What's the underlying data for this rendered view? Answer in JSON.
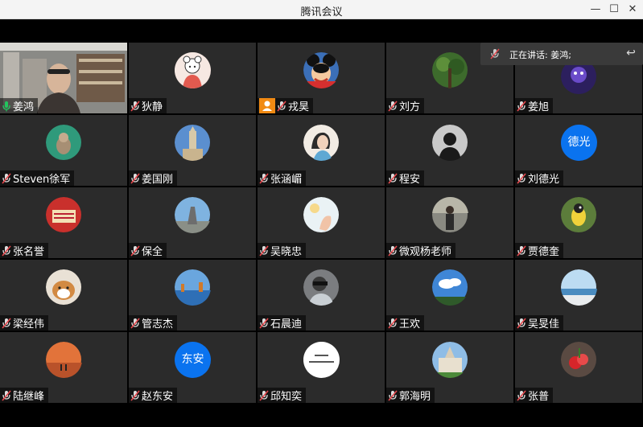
{
  "window": {
    "title": "腾讯会议",
    "minimize": "—",
    "maximize": "☐",
    "close": "✕"
  },
  "speaking_banner": {
    "text": "正在讲话: 姜鸿;"
  },
  "avatar_texts": {
    "liudeguang": "德光",
    "zhaodongan": "东安"
  },
  "colors": {
    "active_border": "#1fbf4f",
    "host_badge": "#f18a13",
    "text_avatar": "#0a73ef",
    "tile_bg": "#2b2b2b"
  },
  "participants": [
    {
      "name": "姜鸿",
      "mic": "on"
    },
    {
      "name": "狄静",
      "mic": "muted"
    },
    {
      "name": "戎昊",
      "mic": "muted",
      "host": true
    },
    {
      "name": "刘方",
      "mic": "muted"
    },
    {
      "name": "姜旭",
      "mic": "muted"
    },
    {
      "name": "Steven徐军",
      "mic": "muted"
    },
    {
      "name": "姜国刚",
      "mic": "muted"
    },
    {
      "name": "张涵嵋",
      "mic": "muted"
    },
    {
      "name": "程安",
      "mic": "muted"
    },
    {
      "name": "刘德光",
      "mic": "muted"
    },
    {
      "name": "张名誉",
      "mic": "muted"
    },
    {
      "name": "保全",
      "mic": "muted"
    },
    {
      "name": "吴晓忠",
      "mic": "muted"
    },
    {
      "name": "微观杨老师",
      "mic": "muted"
    },
    {
      "name": "贾德奎",
      "mic": "muted"
    },
    {
      "name": "梁经伟",
      "mic": "muted"
    },
    {
      "name": "管志杰",
      "mic": "muted"
    },
    {
      "name": "石晨迪",
      "mic": "muted"
    },
    {
      "name": "王欢",
      "mic": "muted"
    },
    {
      "name": "吴旻佳",
      "mic": "muted"
    },
    {
      "name": "陆继峰",
      "mic": "muted"
    },
    {
      "name": "赵东安",
      "mic": "muted"
    },
    {
      "name": "邱知奕",
      "mic": "muted"
    },
    {
      "name": "郭海明",
      "mic": "muted"
    },
    {
      "name": "张普",
      "mic": "muted"
    }
  ]
}
